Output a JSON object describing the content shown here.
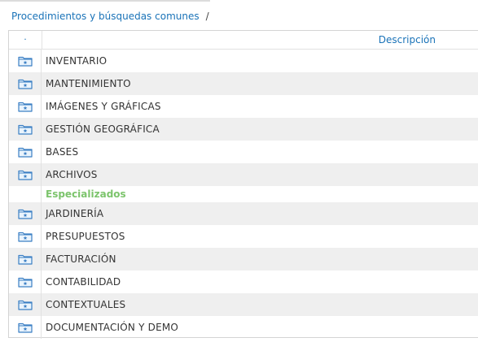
{
  "breadcrumb": {
    "link_label": "Procedimientos y búsquedas comunes",
    "separator": "/"
  },
  "table": {
    "header_marker": "·",
    "description_header": "Descripción"
  },
  "icons": {
    "folder": "folder-star-icon"
  },
  "colors": {
    "link": "#1a73b8",
    "section_heading": "#7cc46c",
    "row_stripe": "#efefef",
    "folder_icon": "#3b7fc4"
  },
  "groups": [
    {
      "heading": "",
      "items": [
        {
          "label": "INVENTARIO"
        },
        {
          "label": "MANTENIMIENTO"
        },
        {
          "label": "IMÁGENES Y GRÁFICAS"
        },
        {
          "label": "GESTIÓN GEOGRÁFICA"
        },
        {
          "label": "BASES"
        },
        {
          "label": "ARCHIVOS"
        }
      ]
    },
    {
      "heading": "Especializados",
      "items": [
        {
          "label": "JARDINERÍA"
        },
        {
          "label": "PRESUPUESTOS"
        },
        {
          "label": "FACTURACIÓN"
        },
        {
          "label": "CONTABILIDAD"
        },
        {
          "label": "CONTEXTUALES"
        },
        {
          "label": "DOCUMENTACIÓN Y DEMO"
        }
      ]
    }
  ]
}
